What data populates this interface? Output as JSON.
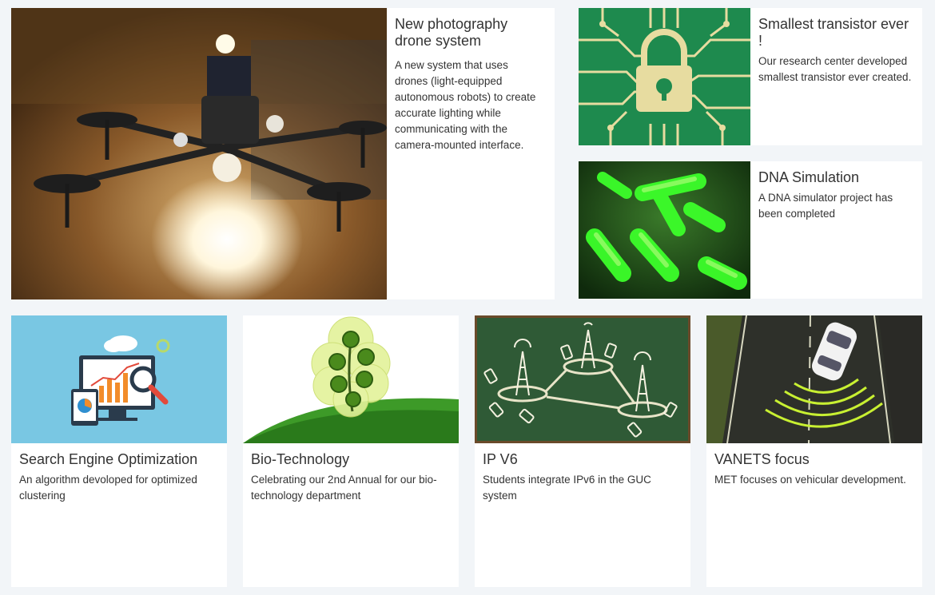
{
  "cards": {
    "drone": {
      "title": "New photography drone system",
      "description": "A new system that uses drones (light-equipped autonomous robots) to create accurate lighting while communicating with the camera-mounted interface."
    },
    "transistor": {
      "title": "Smallest transistor ever !",
      "description": "Our research center developed smallest transistor ever created."
    },
    "dna": {
      "title": "DNA Simulation",
      "description": "A DNA simulator project has been completed"
    },
    "seo": {
      "title": "Search Engine Optimization",
      "description": "An algorithm devoloped for optimized clustering"
    },
    "biotech": {
      "title": "Bio-Technology",
      "description": "Celebrating our 2nd Annual for our bio-technology department"
    },
    "ipv6": {
      "title": "IP V6",
      "description": "Students integrate IPv6 in the GUC system"
    },
    "vanets": {
      "title": "VANETS focus",
      "description": "MET focuses on vehicular development."
    }
  },
  "colors": {
    "page_background": "#f2f5f8",
    "card_background": "#ffffff",
    "text": "#333333"
  }
}
